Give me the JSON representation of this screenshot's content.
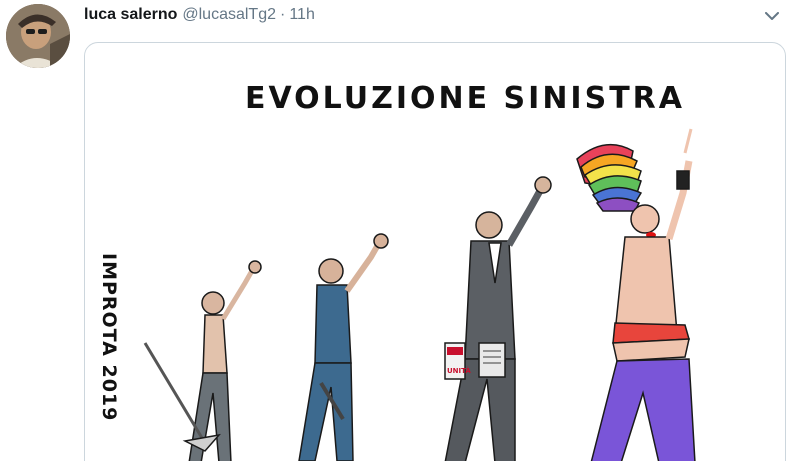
{
  "tweet": {
    "author_name": "luca salerno",
    "handle": "@lucasalTg2",
    "separator": "·",
    "time": "11h",
    "icons": {
      "avatar": "profile-photo",
      "menu": "chevron-down-icon"
    },
    "colors": {
      "name": "#14171a",
      "meta": "#657786",
      "border": "#ccd6dd"
    }
  },
  "cartoon": {
    "title": "EVOLUZIONE SINISTRA",
    "signature": "IMPROTA 2019",
    "newspaper_label": "UNITÀ"
  }
}
